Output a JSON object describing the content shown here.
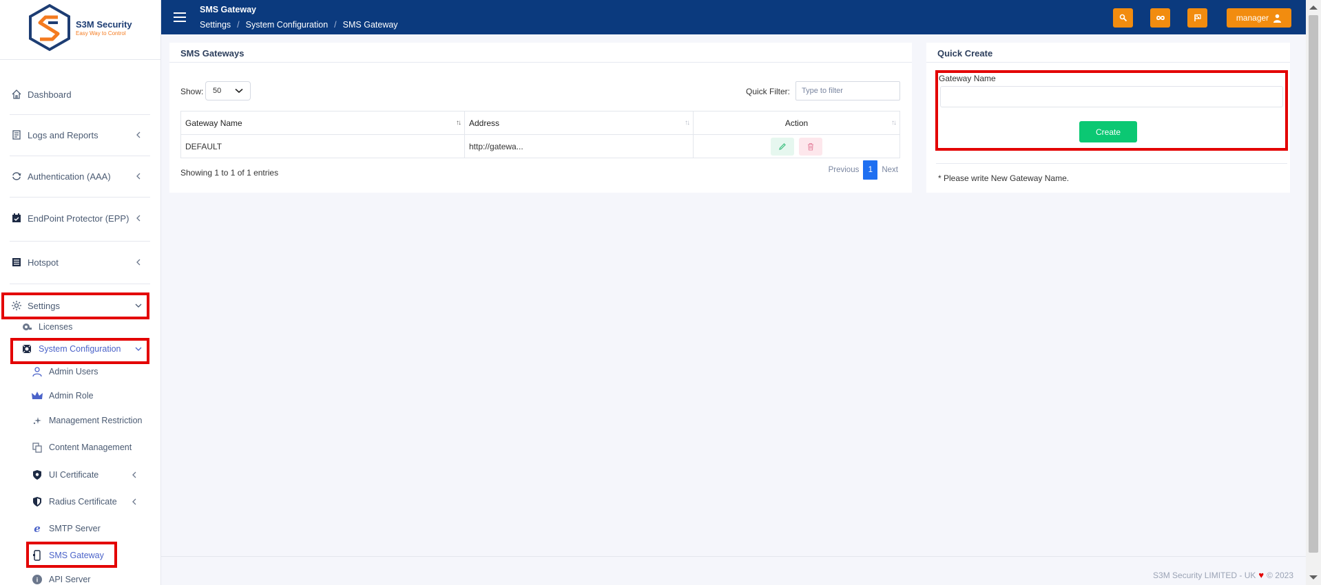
{
  "logo": {
    "name": "S3M Security",
    "tagline": "Easy Way to Control"
  },
  "header": {
    "title": "SMS Gateway",
    "breadcrumb": [
      "Settings",
      "System Configuration",
      "SMS Gateway"
    ],
    "user_label": "manager"
  },
  "sidebar": {
    "items": [
      {
        "label": "Dashboard",
        "icon": "home-icon"
      },
      {
        "label": "Logs and Reports",
        "icon": "report-icon"
      },
      {
        "label": "Authentication (AAA)",
        "icon": "sync-icon"
      },
      {
        "label": "EndPoint Protector (EPP)",
        "icon": "calendar-check-icon"
      },
      {
        "label": "Hotspot",
        "icon": "list-icon"
      },
      {
        "label": "Settings",
        "icon": "gear-icon"
      }
    ],
    "settings_sub": [
      {
        "label": "Licenses"
      },
      {
        "label": "System Configuration"
      }
    ],
    "sysconfig_sub": [
      {
        "label": "Admin Users"
      },
      {
        "label": "Admin Role"
      },
      {
        "label": "Management Restriction"
      },
      {
        "label": "Content Management"
      },
      {
        "label": "UI Certificate"
      },
      {
        "label": "Radius Certificate"
      },
      {
        "label": "SMTP Server"
      },
      {
        "label": "SMS Gateway"
      },
      {
        "label": "API Server"
      }
    ]
  },
  "gateways_panel": {
    "title": "SMS Gateways",
    "show_label": "Show:",
    "show_value": "50",
    "quick_filter_label": "Quick Filter:",
    "quick_filter_placeholder": "Type to filter",
    "columns": [
      "Gateway Name",
      "Address",
      "Action"
    ],
    "rows": [
      {
        "name": "DEFAULT",
        "address": "http://gatewa..."
      }
    ],
    "info": "Showing 1 to 1 of 1 entries",
    "pagination": {
      "previous": "Previous",
      "current": "1",
      "next": "Next"
    }
  },
  "quick_create": {
    "title": "Quick Create",
    "field_label": "Gateway Name",
    "field_value": "",
    "button_label": "Create",
    "note": "* Please write New Gateway Name."
  },
  "footer": {
    "company": "S3M Security LIMITED - UK",
    "year": "© 2023"
  },
  "colors": {
    "header": "#0b3a7e",
    "accent": "#f28c0f",
    "create": "#0bc873",
    "active_link": "#4b63c9",
    "highlight": "#e30000"
  }
}
